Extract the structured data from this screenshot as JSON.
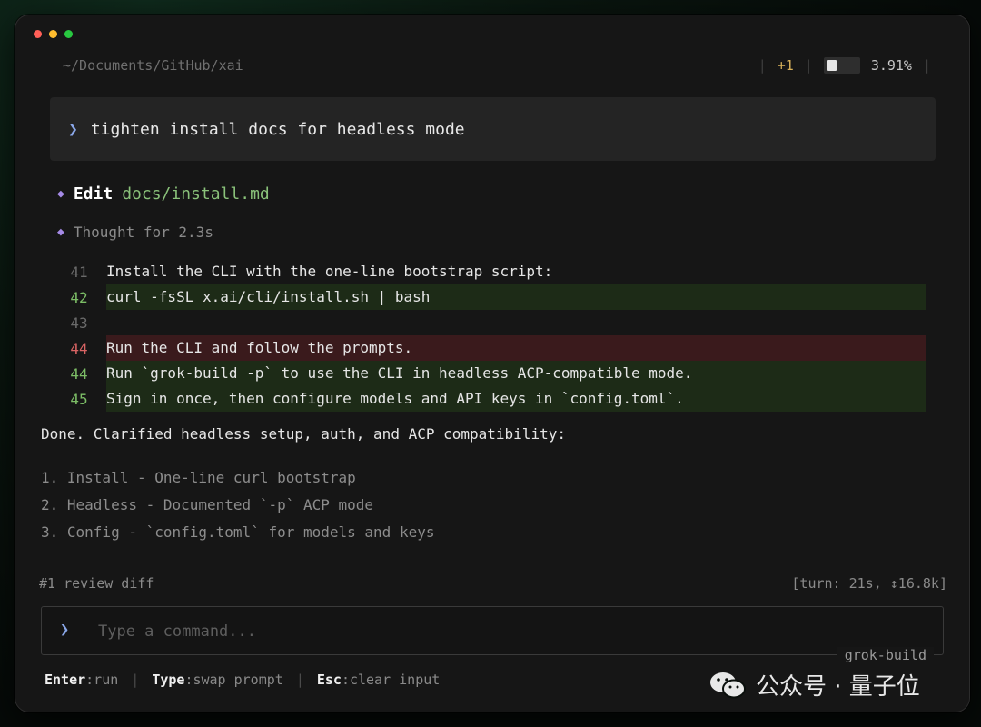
{
  "header": {
    "path": "~/Documents/GitHub/xai",
    "changes": "+1",
    "context_percent": "3.91%",
    "context_fraction": 0.0391
  },
  "prompt": {
    "text": "tighten install docs for headless mode"
  },
  "edit": {
    "label": "Edit",
    "file": "docs/install.md"
  },
  "thought": {
    "text": "Thought for 2.3s"
  },
  "diff": [
    {
      "line": "41",
      "type": "context",
      "text": "Install the CLI with the one-line bootstrap script:"
    },
    {
      "line": "42",
      "type": "added",
      "text": "curl -fsSL x.ai/cli/install.sh | bash"
    },
    {
      "line": "43",
      "type": "context",
      "text": ""
    },
    {
      "line": "44",
      "type": "removed",
      "text": "Run the CLI and follow the prompts."
    },
    {
      "line": "44",
      "type": "added",
      "text": "Run `grok-build -p` to use the CLI in headless ACP-compatible mode."
    },
    {
      "line": "45",
      "type": "added",
      "text": "Sign in once, then configure models and API keys in `config.toml`."
    }
  ],
  "summary": {
    "done": "Done. Clarified headless setup, auth, and ACP compatibility:",
    "items": [
      "1. Install - One-line curl bootstrap",
      "2. Headless - Documented `-p` ACP mode",
      "3. Config - `config.toml` for models and keys"
    ]
  },
  "footer": {
    "review": "#1 review diff",
    "turn": "[turn: 21s, ↕16.8k]"
  },
  "input": {
    "placeholder": "Type a command...",
    "tag": "grok-build"
  },
  "shortcuts": [
    {
      "key": "Enter",
      "action": ":run"
    },
    {
      "key": "Type",
      "action": ":swap prompt"
    },
    {
      "key": "Esc",
      "action": ":clear input"
    }
  ],
  "watermark": {
    "text": "公众号 · 量子位"
  },
  "colors": {
    "accent": "#8aa7e8",
    "added": "#7cbd66",
    "removed": "#d96464",
    "file": "#8ac27a",
    "diamond": "#a58ae6"
  }
}
